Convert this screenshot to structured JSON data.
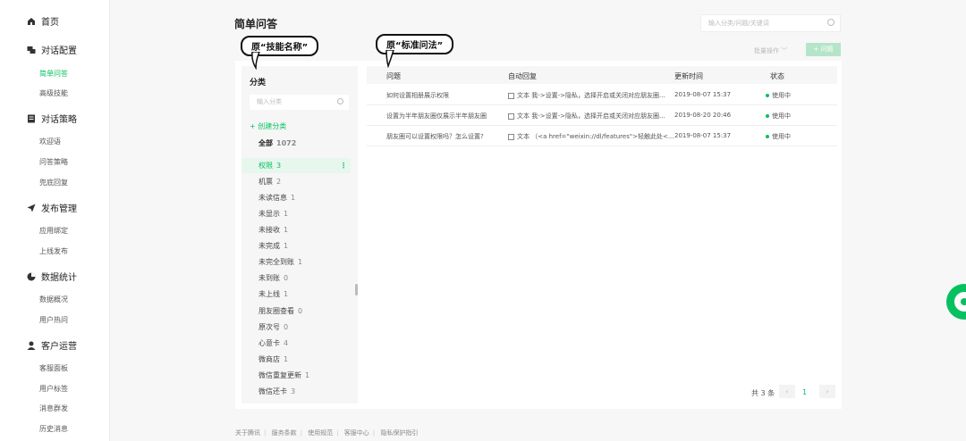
{
  "sidebar": {
    "groups": [
      {
        "label": "首页",
        "icon": "home-icon"
      },
      {
        "label": "对话配置",
        "icon": "chat-icon",
        "items": [
          {
            "label": "简单问答",
            "active": true
          },
          {
            "label": "高级技能"
          }
        ]
      },
      {
        "label": "对话策略",
        "icon": "list-icon",
        "items": [
          {
            "label": "欢迎语"
          },
          {
            "label": "问答策略"
          },
          {
            "label": "兜底回复"
          }
        ]
      },
      {
        "label": "发布管理",
        "icon": "send-icon",
        "items": [
          {
            "label": "应用绑定"
          },
          {
            "label": "上线发布"
          }
        ]
      },
      {
        "label": "数据统计",
        "icon": "pie-chart-icon",
        "items": [
          {
            "label": "数据概况"
          },
          {
            "label": "用户热问"
          }
        ]
      },
      {
        "label": "客户运营",
        "icon": "user-icon",
        "items": [
          {
            "label": "客服面板"
          },
          {
            "label": "用户标签"
          },
          {
            "label": "消息群发"
          },
          {
            "label": "历史消息"
          }
        ]
      }
    ]
  },
  "page": {
    "title": "简单问答",
    "search_placeholder": "输入分类/问题/关键词",
    "batch_label": "批量操作",
    "add_label": "问题"
  },
  "callouts": {
    "left": "原“技能名称”",
    "right": "原“标准问法”"
  },
  "categories": {
    "title": "分类",
    "search_placeholder": "输入分类",
    "create_label": "创建分类",
    "items": [
      {
        "name": "全部",
        "count": "1072",
        "bold": true
      },
      {
        "name": "权限",
        "count": "3",
        "active": true
      },
      {
        "name": "机票",
        "count": "2"
      },
      {
        "name": "未读信息",
        "count": "1"
      },
      {
        "name": "未显示",
        "count": "1"
      },
      {
        "name": "未接收",
        "count": "1"
      },
      {
        "name": "未完成",
        "count": "1"
      },
      {
        "name": "未完全到账",
        "count": "1"
      },
      {
        "name": "未到账",
        "count": "0"
      },
      {
        "name": "未上线",
        "count": "1"
      },
      {
        "name": "朋友圈查看",
        "count": "0"
      },
      {
        "name": "原次号",
        "count": "0"
      },
      {
        "name": "心意卡",
        "count": "4"
      },
      {
        "name": "微商店",
        "count": "1"
      },
      {
        "name": "微信重复更新",
        "count": "1"
      },
      {
        "name": "微信还卡",
        "count": "3"
      }
    ]
  },
  "table": {
    "headers": {
      "question": "问题",
      "reply": "自动回复",
      "updated": "更新时间",
      "status": "状态"
    },
    "rows": [
      {
        "question": "如何设置相册展示权限",
        "reply": "文本 我->设置->隐私，选择开启或关闭对应朋友圈...",
        "updated": "2019-08-07 15:37",
        "status": "使用中"
      },
      {
        "question": "设置为半年朋友圈仅展示半年朋友圈",
        "reply": "文本 我->设置->隐私，选择开启或关闭对应朋友圈...",
        "updated": "2019-08-20 20:46",
        "status": "使用中"
      },
      {
        "question": "朋友圈可以设置权限吗？怎么设置?",
        "reply": "文本 （<a href=\"weixin://dl/features\">轻触此处<...",
        "updated": "2019-08-07 15:37",
        "status": "使用中"
      }
    ]
  },
  "pager": {
    "total": "共 3 条",
    "current": "1",
    "prev": "‹",
    "next": "›"
  },
  "footer": {
    "links": [
      "关于腾讯",
      "服务条款",
      "使用规范",
      "客服中心",
      "隐私保护指引"
    ],
    "separator": "|"
  },
  "colors": {
    "accent": "#07c160",
    "accent_light": "#e7f7ed",
    "disabled_btn": "#b5e5c8"
  }
}
